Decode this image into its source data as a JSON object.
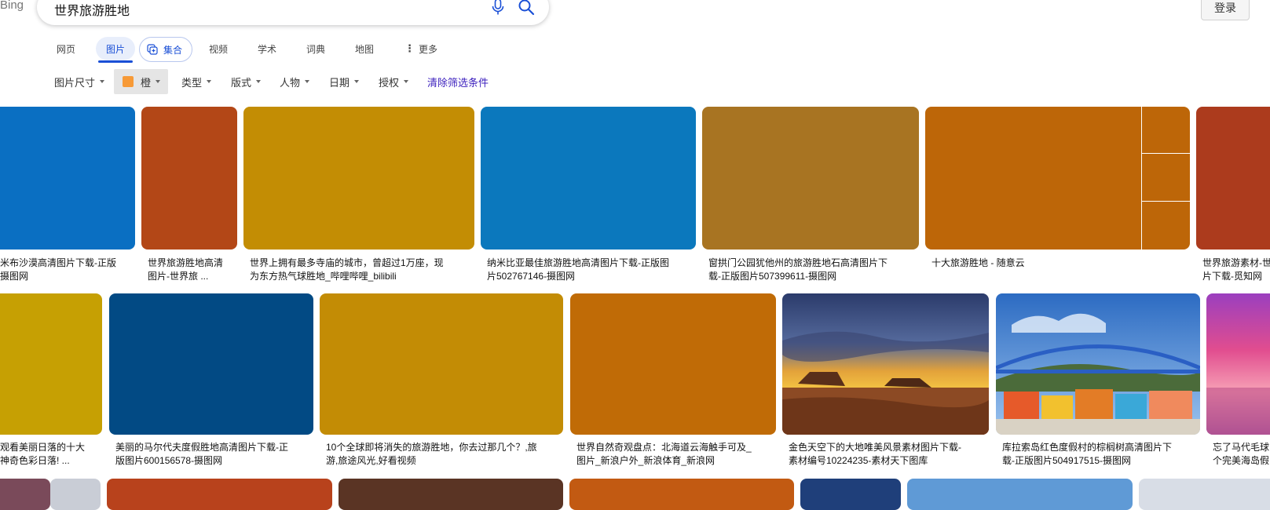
{
  "header": {
    "logo": "Bing",
    "search_query": "世界旅游胜地",
    "login_label": "登录"
  },
  "tabs": [
    {
      "label": "网页"
    },
    {
      "label": "图片",
      "active": true
    },
    {
      "label": "集合"
    },
    {
      "label": "视频"
    },
    {
      "label": "学术"
    },
    {
      "label": "词典"
    },
    {
      "label": "地图"
    },
    {
      "label": "更多"
    }
  ],
  "filters": {
    "size": "图片尺寸",
    "color": "橙",
    "color_swatch": "#f79a37",
    "type": "类型",
    "layout": "版式",
    "people": "人物",
    "date": "日期",
    "license": "授权",
    "clear": "清除筛选条件"
  },
  "results": {
    "row1": [
      {
        "color": "#0a6fc2",
        "caption1": "米布沙漠高清图片下载-正版",
        "caption2": "摄图网"
      },
      {
        "color": "#b34717",
        "caption1": "世界旅游胜地高清",
        "caption2": "图片-世界旅 ..."
      },
      {
        "color": "#c38d04",
        "caption1": "世界上拥有最多寺庙的城市，曾超过1万座，现",
        "caption2": "为东方热气球胜地_哔哩哔哩_bilibili"
      },
      {
        "color": "#0b78bd",
        "caption1": "纳米比亚最佳旅游胜地高清图片下载-正版图",
        "caption2": "片502767146-摄图网"
      },
      {
        "color": "#a87422",
        "caption1": "窗拱门公园犹他州的旅游胜地石高清图片下",
        "caption2": "载-正版图片507399611-摄图网"
      },
      {
        "color": "#bd6608",
        "caption1": "十大旅游胜地 - 随意云",
        "caption2": ""
      },
      {
        "color": "#ac3b1d",
        "caption1": "世界旅游素材-世",
        "caption2": "片下载-觅知网"
      }
    ],
    "row2": [
      {
        "color": "#c6a003",
        "caption1": "观看美丽日落的十大",
        "caption2": "神奇色彩日落! ..."
      },
      {
        "color": "#024a84",
        "caption1": "美丽的马尔代夫度假胜地高清图片下载-正",
        "caption2": "版图片600156578-摄图网"
      },
      {
        "color": "#c38c05",
        "caption1": "10个全球即将消失的旅游胜地，你去过那几个？,旅",
        "caption2": "游,旅途风光,好看视频"
      },
      {
        "color": "#c06b06",
        "caption1": "世界自然奇观盘点：北海道云海触手可及_",
        "caption2": "图片_新浪户外_新浪体育_新浪网"
      },
      {
        "color": "#9a5a2a",
        "caption1": "金色天空下的大地唯美风景素材图片下载-",
        "caption2": "素材编号10224235-素材天下图库"
      },
      {
        "color": "#3f7ec8",
        "caption1": "库拉索岛红色度假村的棕榈树高清图片下",
        "caption2": "载-正版图片504917515-摄图网"
      },
      {
        "color": "#d04a8a",
        "caption1": "忘了马代毛球",
        "caption2": "个完美海岛假"
      }
    ]
  }
}
